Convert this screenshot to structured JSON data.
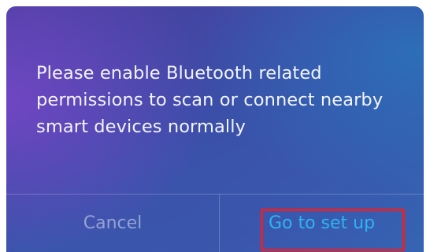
{
  "dialog": {
    "message": "Please enable Bluetooth related permissions to scan or connect nearby smart devices normally",
    "cancel_label": "Cancel",
    "confirm_label": "Go to set up"
  },
  "colors": {
    "confirm_text": "#2fb3f0",
    "cancel_text": "#a7adc3",
    "highlight_border": "#e8202a"
  }
}
